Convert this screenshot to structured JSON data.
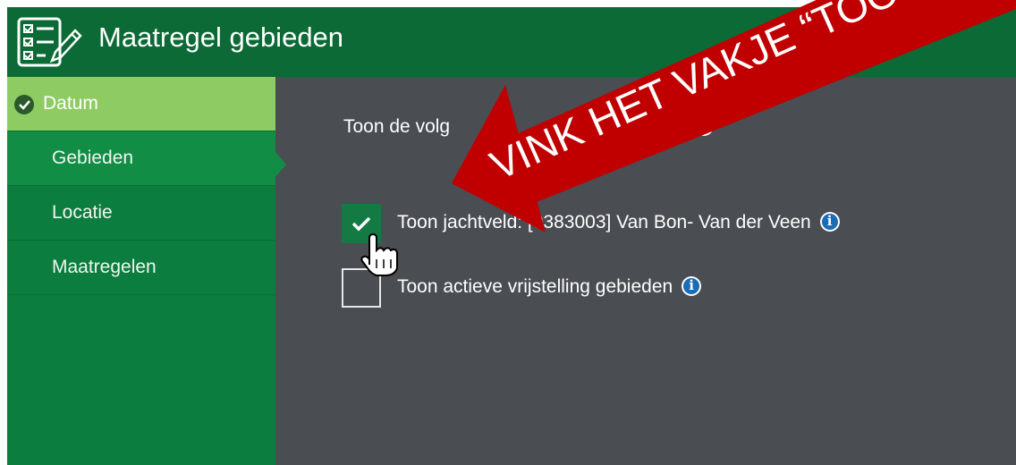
{
  "header": {
    "title": "Maatregel gebieden",
    "icon": "checklist-edit-icon"
  },
  "sidebar": {
    "items": [
      {
        "label": "Datum",
        "state": "completed"
      },
      {
        "label": "Gebieden",
        "state": "active"
      },
      {
        "label": "Locatie",
        "state": "default"
      },
      {
        "label": "Maatregelen",
        "state": "default"
      }
    ]
  },
  "content": {
    "intro": "Toon de volg",
    "intro_tail": "kaart",
    "options": [
      {
        "label": "Toon jachtveld: [0383003] Van Bon- Van der Veen",
        "checked": true
      },
      {
        "label": "Toon actieve vrijstelling gebieden",
        "checked": false
      }
    ]
  },
  "annotation": {
    "text": "VINK HET VAKJE “TOON JACHT"
  },
  "colors": {
    "header": "#0b6a35",
    "sidebar": "#0b7d3e",
    "sidebar_active": "#128d46",
    "sidebar_completed": "#8fcb63",
    "content": "#4a4d52",
    "checkbox_checked": "#137a44",
    "annotation": "#c00000",
    "info": "#1b6bb5"
  }
}
